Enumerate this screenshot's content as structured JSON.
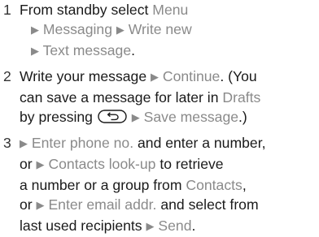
{
  "steps": [
    {
      "number": "1",
      "t1": "From standby select ",
      "menu": "Menu",
      "messaging": "Messaging",
      "write_new": "Write new",
      "text_message": "Text message",
      "end": "."
    },
    {
      "number": "2",
      "t1": "Write your message ",
      "continue": "Continue",
      "t2": ". (You",
      "t3": "can save a message for later in ",
      "drafts": "Drafts",
      "t4": "by pressing ",
      "back_key_icon": "back-arrow-key",
      "save_message": "Save message",
      "t5": ".)"
    },
    {
      "number": "3",
      "enter_phone_no": "Enter phone no.",
      "t1": " and enter a number,",
      "t2": "or ",
      "contacts_lookup": "Contacts look-up",
      "t3": " to retrieve",
      "t4": "a number or a group from ",
      "contacts": "Contacts",
      "t5": ",",
      "t6": "or ",
      "enter_email_addr": "Enter email addr.",
      "t7": " and select from",
      "t8": "last used recipients ",
      "send": "Send",
      "t9": "."
    }
  ],
  "arrow_glyph": "▶",
  "colors": {
    "text": "#1a1a1a",
    "menu_term": "#8a8a8a"
  }
}
